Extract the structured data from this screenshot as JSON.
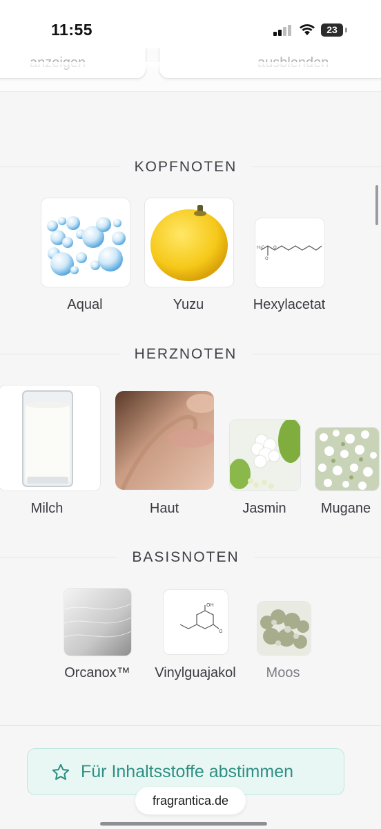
{
  "status_bar": {
    "time": "11:55",
    "battery": "23"
  },
  "top_buttons": {
    "left_label": "anzeigen",
    "right_label": "ausblenden"
  },
  "sections": {
    "kopfnoten": {
      "title": "KOPFNOTEN",
      "notes": [
        {
          "label": "Aqual",
          "icon": "bubbles-image"
        },
        {
          "label": "Yuzu",
          "icon": "yuzu-image"
        },
        {
          "label": "Hexylacetat",
          "icon": "molecule-image"
        }
      ]
    },
    "herznoten": {
      "title": "HERZNOTEN",
      "notes": [
        {
          "label": "Milch",
          "icon": "milk-glass-image"
        },
        {
          "label": "Haut",
          "icon": "skin-image"
        },
        {
          "label": "Jasmin",
          "icon": "jasmine-image"
        },
        {
          "label": "Mugane",
          "icon": "white-flowers-image"
        }
      ]
    },
    "basisnoten": {
      "title": "BASISNOTEN",
      "notes": [
        {
          "label": "Orcanox™",
          "icon": "fur-image"
        },
        {
          "label": "Vinylguajakol",
          "icon": "molecule-image"
        },
        {
          "label": "Moos",
          "icon": "moss-image"
        }
      ]
    }
  },
  "vote_button": {
    "label": "Für Inhaltsstoffe abstimmen",
    "icon": "star-icon",
    "color": "#2f8f84"
  },
  "url_pill": {
    "domain": "fragrantica.de"
  },
  "colors": {
    "background": "#f6f6f7",
    "accent": "#2f8f84"
  }
}
